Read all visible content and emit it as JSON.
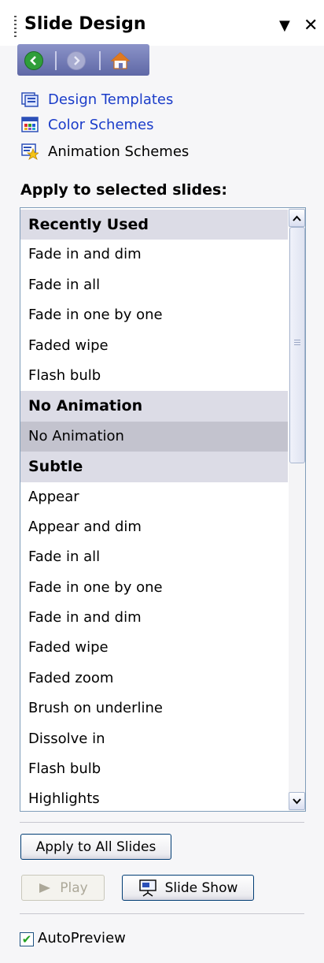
{
  "header": {
    "title": "Slide Design",
    "menu_glyph": "▼",
    "close_glyph": "✕"
  },
  "nav": {
    "back_icon": "back-arrow-icon",
    "forward_icon": "forward-arrow-icon",
    "home_icon": "home-icon"
  },
  "links": [
    {
      "label": "Design Templates",
      "icon": "design-templates-icon",
      "color": "#1a3cc9"
    },
    {
      "label": "Color Schemes",
      "icon": "color-schemes-icon",
      "color": "#1a3cc9"
    },
    {
      "label": "Animation Schemes",
      "icon": "animation-schemes-icon",
      "color": "#000000"
    }
  ],
  "section_label": "Apply to selected slides:",
  "list": [
    {
      "label": "Recently Used",
      "type": "header"
    },
    {
      "label": "Fade in and dim",
      "type": "item"
    },
    {
      "label": "Fade in all",
      "type": "item"
    },
    {
      "label": "Fade in one by one",
      "type": "item"
    },
    {
      "label": "Faded wipe",
      "type": "item"
    },
    {
      "label": "Flash bulb",
      "type": "item"
    },
    {
      "label": "No Animation",
      "type": "header"
    },
    {
      "label": "No Animation",
      "type": "item",
      "selected": true
    },
    {
      "label": "Subtle",
      "type": "header"
    },
    {
      "label": "Appear",
      "type": "item"
    },
    {
      "label": "Appear and dim",
      "type": "item"
    },
    {
      "label": "Fade in all",
      "type": "item"
    },
    {
      "label": "Fade in one by one",
      "type": "item"
    },
    {
      "label": "Fade in and dim",
      "type": "item"
    },
    {
      "label": "Faded wipe",
      "type": "item"
    },
    {
      "label": "Faded zoom",
      "type": "item"
    },
    {
      "label": "Brush on underline",
      "type": "item"
    },
    {
      "label": "Dissolve in",
      "type": "item"
    },
    {
      "label": "Flash bulb",
      "type": "item"
    },
    {
      "label": "Highlights",
      "type": "item"
    }
  ],
  "buttons": {
    "apply_all": "Apply to All Slides",
    "play": "Play",
    "slide_show": "Slide Show"
  },
  "autopreview": {
    "label": "AutoPreview",
    "checked": true
  },
  "colors": {
    "nav_strip": "#6d75b4",
    "link": "#1a3cc9",
    "group_header_bg": "#dcdce6",
    "selected_bg": "#c3c3ce",
    "checkmark": "#21a121"
  }
}
